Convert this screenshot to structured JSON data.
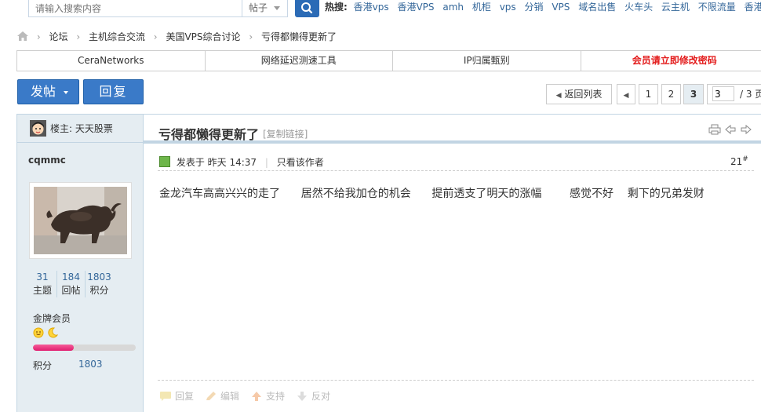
{
  "search": {
    "placeholder": "请输入搜索内容",
    "type": "帖子"
  },
  "hot": {
    "label": "热搜:",
    "words": [
      "香港vps",
      "香港VPS",
      "amh",
      "机柜",
      "vps",
      "分销",
      "VPS",
      "域名出售",
      "火车头",
      "云主机",
      "不限流量",
      "香港服务器"
    ]
  },
  "breadcrumb": [
    "论坛",
    "主机综合交流",
    "美国VPS综合讨论",
    "亏得都懒得更新了"
  ],
  "nav_tabs": [
    "CeraNetworks",
    "网络延迟测速工具",
    "IP归属甄别",
    "会员请立即修改密码"
  ],
  "buttons": {
    "post": "发帖",
    "reply": "回复"
  },
  "pager": {
    "back": "返回列表",
    "pages": [
      "1",
      "2",
      "3"
    ],
    "current": "3",
    "input_value": "3",
    "total": "/ 3 页"
  },
  "author": {
    "host_label": "楼主: 天天股票",
    "username": "cqmmc",
    "stats": [
      {
        "num": "31",
        "label": "主题"
      },
      {
        "num": "184",
        "label": "回帖"
      },
      {
        "num": "1803",
        "label": "积分"
      }
    ],
    "grade": "金牌会员",
    "score_label": "积分",
    "score_value": "1803",
    "level_progress": 0.4
  },
  "post": {
    "title": "亏得都懒得更新了",
    "copy_link": "[复制链接]",
    "posted_at": "发表于 昨天 14:37",
    "only_author": "只看该作者",
    "floor": "21",
    "floor_sup": "#",
    "content": "金龙汽车高高兴兴的走了      居然不给我加仓的机会      提前透支了明天的涨幅        感觉不好    剩下的兄弟发财"
  },
  "actions": [
    "回复",
    "编辑",
    "支持",
    "反对"
  ],
  "colors": {
    "accent_blue": "#3a7ac8",
    "link_blue": "#336699",
    "sidebar_bg": "#e5edf2",
    "red": "#e31b1b"
  }
}
